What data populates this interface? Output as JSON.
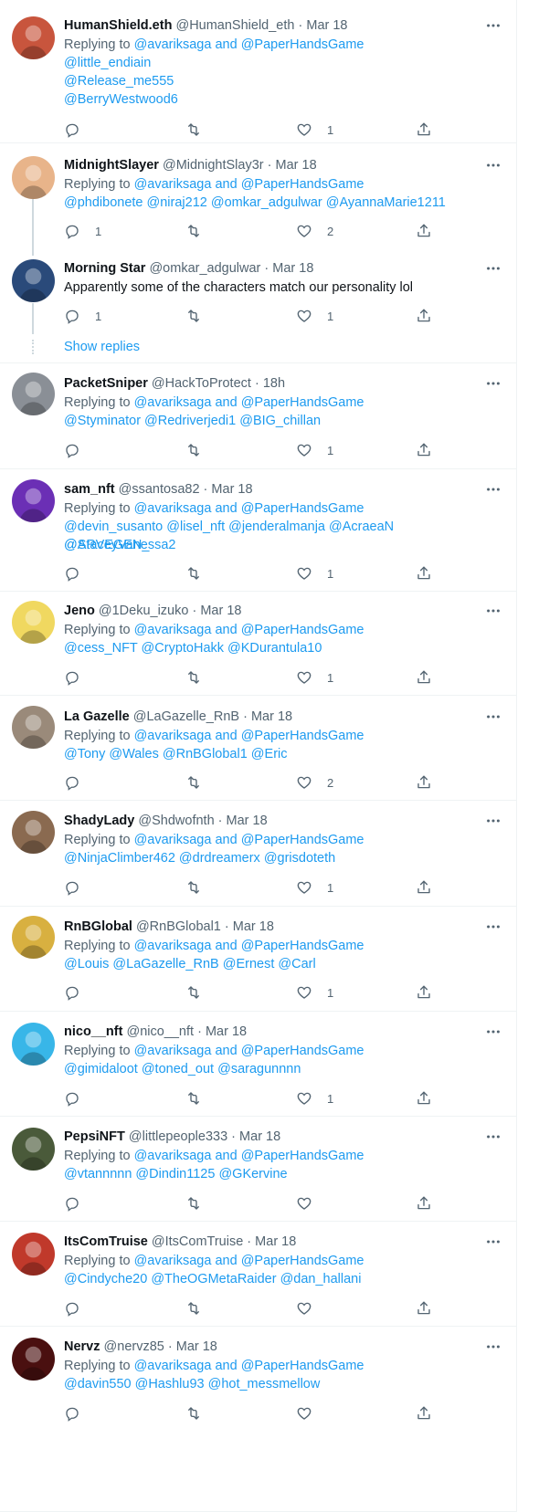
{
  "ui": {
    "replying_to": "Replying to",
    "and_word": "and",
    "show_replies": "Show replies",
    "more_icon": "more-icon",
    "colors": {
      "link": "#1d9bf0",
      "muted": "#536471",
      "text": "#0f1419",
      "divider": "#eff3f4"
    }
  },
  "tweets": [
    {
      "name": "HumanShield.eth",
      "handle": "@HumanShield_eth",
      "time": "Mar 18",
      "reply_to": [
        "@avariksaga",
        "@PaperHandsGame"
      ],
      "mentions_lines": [
        "@little_endiain",
        "@Release_me555",
        "@BerryWestwood6"
      ],
      "replies": "",
      "likes": "1"
    },
    {
      "name": "MidnightSlayer",
      "handle": "@MidnightSlay3r",
      "time": "Mar 18",
      "reply_to": [
        "@avariksaga",
        "@PaperHandsGame"
      ],
      "mentions_lines": [
        "@phdibonete @niraj212 @omkar_adgulwar @AyannaMarie1211"
      ],
      "replies": "1",
      "likes": "2"
    },
    {
      "name": "Morning Star",
      "handle": "@omkar_adgulwar",
      "time": "Mar 18",
      "text": "Apparently some of the characters match our personality lol",
      "replies": "1",
      "likes": "1"
    },
    {
      "name": "PacketSniper",
      "handle": "@HackToProtect",
      "time": "18h",
      "reply_to": [
        "@avariksaga",
        "@PaperHandsGame"
      ],
      "mentions_lines": [
        "@Styminator @Redriverjedi1 @BIG_chillan"
      ],
      "replies": "",
      "likes": "1"
    },
    {
      "name": "sam_nft",
      "handle": "@ssantosa82",
      "time": "Mar 18",
      "reply_to": [
        "@avariksaga",
        "@PaperHandsGame"
      ],
      "mentions_lines": [
        "@devin_susanto @lisel_nft @jenderalmanja @AcraeaN @StaceyVanessa2",
        "@ARVEGEN_"
      ],
      "replies": "",
      "likes": "1"
    },
    {
      "name": "Jeno",
      "handle": "@1Deku_izuko",
      "time": "Mar 18",
      "reply_to": [
        "@avariksaga",
        "@PaperHandsGame"
      ],
      "mentions_lines": [
        "@cess_NFT  @CryptoHakk  @KDurantula10"
      ],
      "replies": "",
      "likes": "1"
    },
    {
      "name": "La Gazelle",
      "handle": "@LaGazelle_RnB",
      "time": "Mar 18",
      "reply_to": [
        "@avariksaga",
        "@PaperHandsGame"
      ],
      "mentions_lines": [
        "@Tony @Wales @RnBGlobal1 @Eric"
      ],
      "replies": "",
      "likes": "2"
    },
    {
      "name": "ShadyLady",
      "handle": "@Shdwofnth",
      "time": "Mar 18",
      "reply_to": [
        "@avariksaga",
        "@PaperHandsGame"
      ],
      "mentions_lines": [
        "@NinjaClimber462 @drdreamerx @grisdoteth"
      ],
      "replies": "",
      "likes": "1"
    },
    {
      "name": "RnBGlobal",
      "handle": "@RnBGlobal1",
      "time": "Mar 18",
      "reply_to": [
        "@avariksaga",
        "@PaperHandsGame"
      ],
      "mentions_lines": [
        "@Louis @LaGazelle_RnB @Ernest @Carl"
      ],
      "replies": "",
      "likes": "1"
    },
    {
      "name": "nico__nft",
      "handle": "@nico__nft",
      "time": "Mar 18",
      "reply_to": [
        "@avariksaga",
        "@PaperHandsGame"
      ],
      "mentions_lines": [
        "@gimidaloot @toned_out @saragunnnn"
      ],
      "replies": "",
      "likes": "1"
    },
    {
      "name": "PepsiNFT",
      "handle": "@littlepeople333",
      "time": "Mar 18",
      "reply_to": [
        "@avariksaga",
        "@PaperHandsGame"
      ],
      "mentions_lines": [
        "@vtannnnn @Dindin1125 @GKervine"
      ],
      "replies": "",
      "likes": ""
    },
    {
      "name": "ItsComTruise",
      "handle": "@ItsComTruise",
      "time": "Mar 18",
      "reply_to": [
        "@avariksaga",
        "@PaperHandsGame"
      ],
      "mentions_lines": [
        "@Cindyche20 @TheOGMetaRaider @dan_hallani"
      ],
      "replies": "",
      "likes": ""
    },
    {
      "name": "Nervz",
      "handle": "@nervz85",
      "time": "Mar 18",
      "reply_to": [
        "@avariksaga",
        "@PaperHandsGame"
      ],
      "mentions_lines": [
        "@davin550 @Hashlu93 @hot_messmellow"
      ],
      "replies": "",
      "likes": ""
    }
  ]
}
